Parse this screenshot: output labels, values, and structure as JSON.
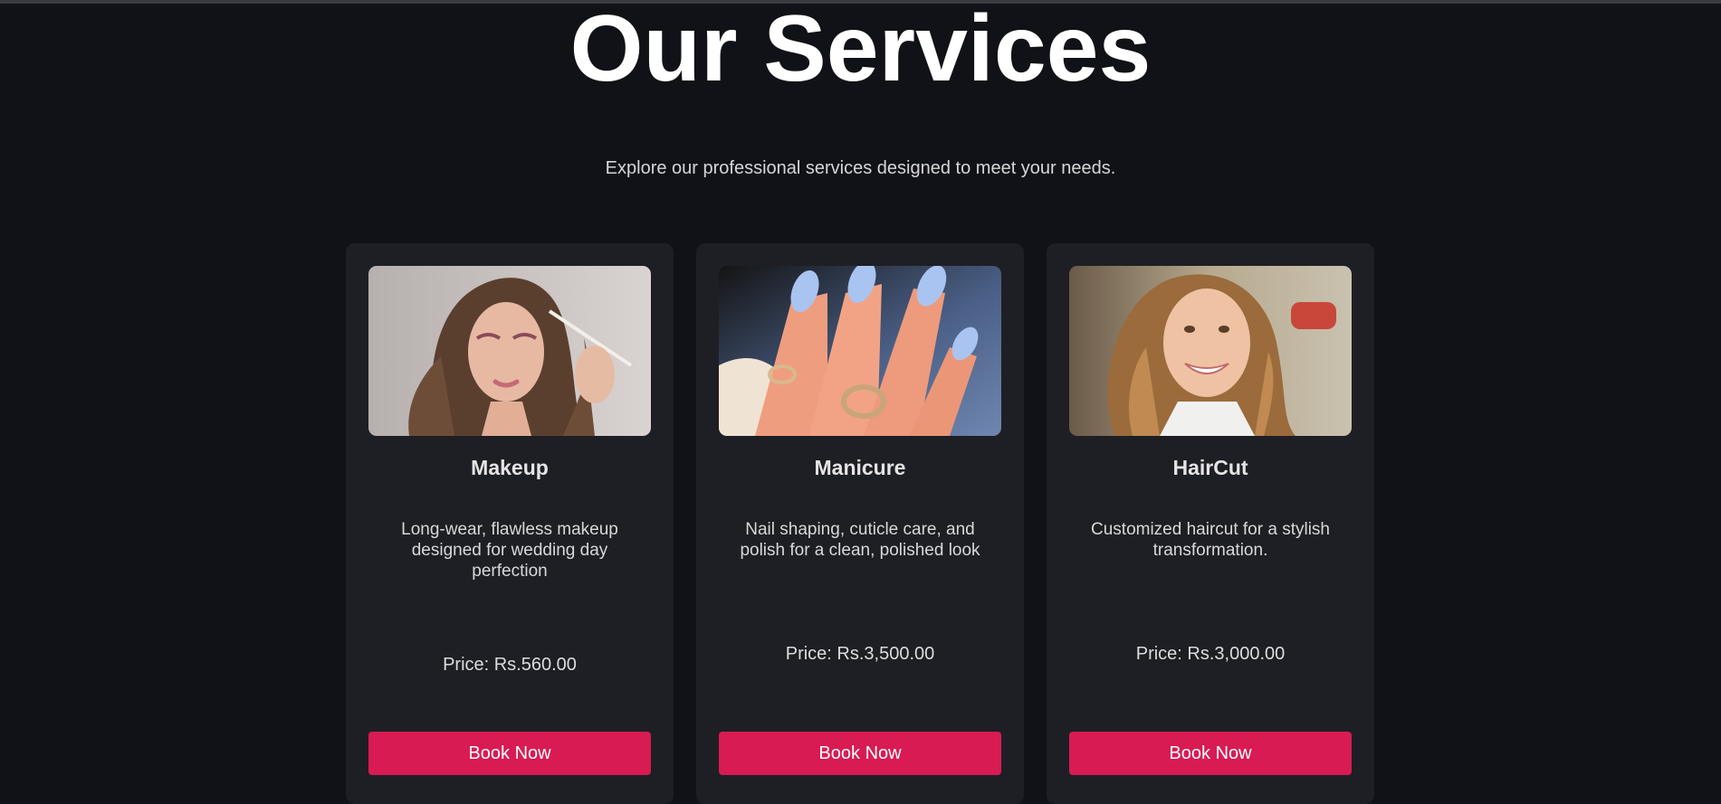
{
  "page": {
    "title": "Our Services",
    "subtitle": "Explore our professional services designed to meet your needs."
  },
  "colors": {
    "background": "#111217",
    "card": "#1e1f24",
    "accent": "#d81b53"
  },
  "services": [
    {
      "image_icon": "makeup-photo",
      "title": "Makeup",
      "description": "Long-wear, flawless makeup designed for wedding day perfection",
      "price": "Price: Rs.560.00",
      "button_label": "Book Now"
    },
    {
      "image_icon": "manicure-photo",
      "title": "Manicure",
      "description": "Nail shaping, cuticle care, and polish for a clean, polished look",
      "price": "Price: Rs.3,500.00",
      "button_label": "Book Now"
    },
    {
      "image_icon": "haircut-photo",
      "title": "HairCut",
      "description": "Customized haircut for a stylish transformation.",
      "price": "Price: Rs.3,000.00",
      "button_label": "Book Now"
    }
  ]
}
